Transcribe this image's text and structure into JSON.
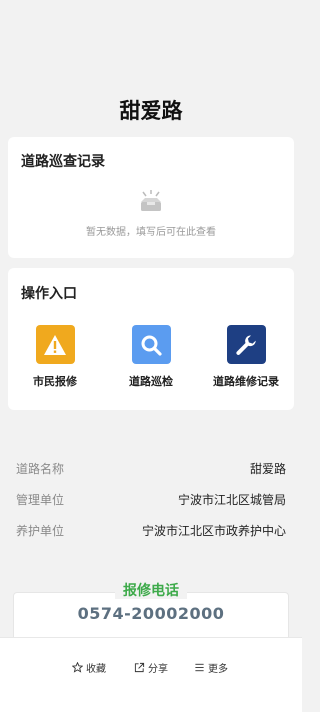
{
  "page": {
    "title": "甜爱路"
  },
  "records": {
    "title": "道路巡查记录",
    "empty_text": "暂无数据，填写后可在此查看"
  },
  "operations": {
    "title": "操作入口",
    "items": [
      {
        "label": "市民报修",
        "icon": "warning-icon",
        "color": "#f0a91e"
      },
      {
        "label": "道路巡检",
        "icon": "search-icon",
        "color": "#5b9cf0"
      },
      {
        "label": "道路维修记录",
        "icon": "wrench-icon",
        "color": "#1e3f83"
      }
    ]
  },
  "info": {
    "rows": [
      {
        "key": "道路名称",
        "value": "甜爱路"
      },
      {
        "key": "管理单位",
        "value": "宁波市江北区城管局"
      },
      {
        "key": "养护单位",
        "value": "宁波市江北区市政养护中心"
      }
    ]
  },
  "hotline": {
    "label": "报修电话",
    "number": "0574-20002000",
    "label_color": "#3daa4a"
  },
  "bottom_bar": {
    "favorite": "收藏",
    "share": "分享",
    "more": "更多"
  }
}
